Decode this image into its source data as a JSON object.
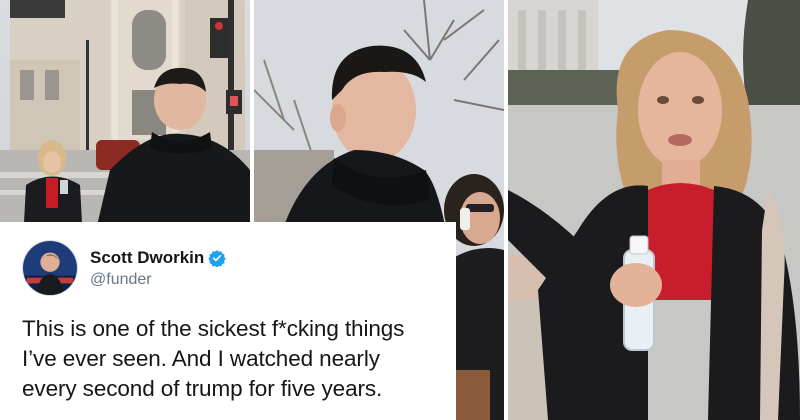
{
  "tweet": {
    "display_name": "Scott Dworkin",
    "handle": "@funder",
    "text": "This is one of the sickest f*cking things I’ve ever seen. And I watched nearly every second of trump for five years.",
    "verified_color": "#1da1f2",
    "avatar_icon": "profile-photo-icon",
    "verified_icon": "verified-badge-icon"
  },
  "panels": [
    {
      "description_icon": "street-scene-photo"
    },
    {
      "description_icon": "closeup-walking-photo"
    },
    {
      "description_icon": "woman-with-water-bottle-photo"
    }
  ]
}
